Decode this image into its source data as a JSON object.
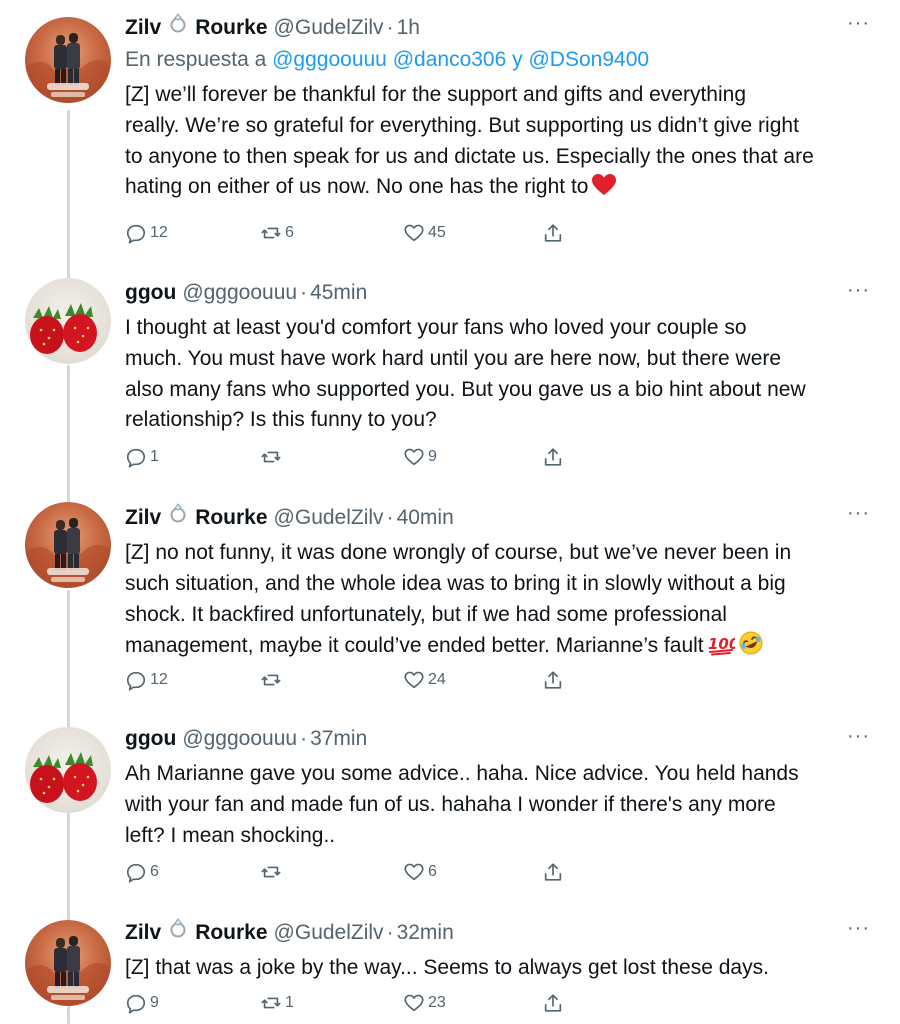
{
  "tweets": [
    {
      "author": {
        "name_first": "Zilv",
        "name_last": "Rourke",
        "handle": "@GudelZilv",
        "avatar": "zilv-avatar"
      },
      "time": "1h",
      "reply_to": {
        "prefix": "En respuesta a",
        "mentions": [
          "@gggoouuu",
          "@danco306",
          "@DSon9400"
        ],
        "connector": "y"
      },
      "lines": [
        "[Z] we’ll forever be thankful for the support and gifts and everything",
        "really. We’re so grateful for everything. But supporting us didn’t give right",
        "to anyone to then speak for us and dictate us. Especially the ones that are",
        "hating on either of us now. No one has the right to"
      ],
      "emoji": [
        "red-heart-emoji"
      ],
      "counts": {
        "replies": "12",
        "retweets": "6",
        "likes": "45"
      }
    },
    {
      "author": {
        "name": "ggou",
        "handle": "@gggoouuu",
        "avatar": "strawberry-avatar"
      },
      "time": "45min",
      "lines": [
        "I thought at least you'd comfort your fans who loved your couple so",
        "much. You must have work hard until you are here now, but there were",
        "also many fans who supported you. But you gave us a bio hint about new",
        "relationship? Is this funny to you?"
      ],
      "counts": {
        "replies": "1",
        "retweets": "",
        "likes": "9"
      }
    },
    {
      "author": {
        "name_first": "Zilv",
        "name_last": "Rourke",
        "handle": "@GudelZilv",
        "avatar": "zilv-avatar"
      },
      "time": "40min",
      "lines": [
        "[Z] no not funny, it was done wrongly of course, but we’ve never been in",
        "such situation, and the whole idea was to bring it in slowly without a big",
        "shock. It backfired unfortunately, but if we had some professional",
        "management, maybe it could’ve ended better. Marianne’s fault"
      ],
      "emoji": [
        "hundred-points-emoji",
        "rofl-emoji"
      ],
      "counts": {
        "replies": "12",
        "retweets": "",
        "likes": "24"
      }
    },
    {
      "author": {
        "name": "ggou",
        "handle": "@gggoouuu",
        "avatar": "strawberry-avatar"
      },
      "time": "37min",
      "lines": [
        "Ah Marianne gave you some advice.. haha. Nice advice. You held hands",
        "with your fan and made fun of us. hahaha I wonder if there's any more",
        "left? I mean shocking.."
      ],
      "counts": {
        "replies": "6",
        "retweets": "",
        "likes": "6"
      }
    },
    {
      "author": {
        "name_first": "Zilv",
        "name_last": "Rourke",
        "handle": "@GudelZilv",
        "avatar": "zilv-avatar"
      },
      "time": "32min",
      "lines": [
        "[Z] that was a joke by the way... Seems to always get lost these days."
      ],
      "counts": {
        "replies": "9",
        "retweets": "1",
        "likes": "23"
      }
    }
  ],
  "ui": {
    "separator": "·",
    "more": "···"
  },
  "colors": {
    "text": "#0f1419",
    "secondary": "#536471",
    "link": "#1d9bf0",
    "thread_line": "#cfd9de"
  }
}
